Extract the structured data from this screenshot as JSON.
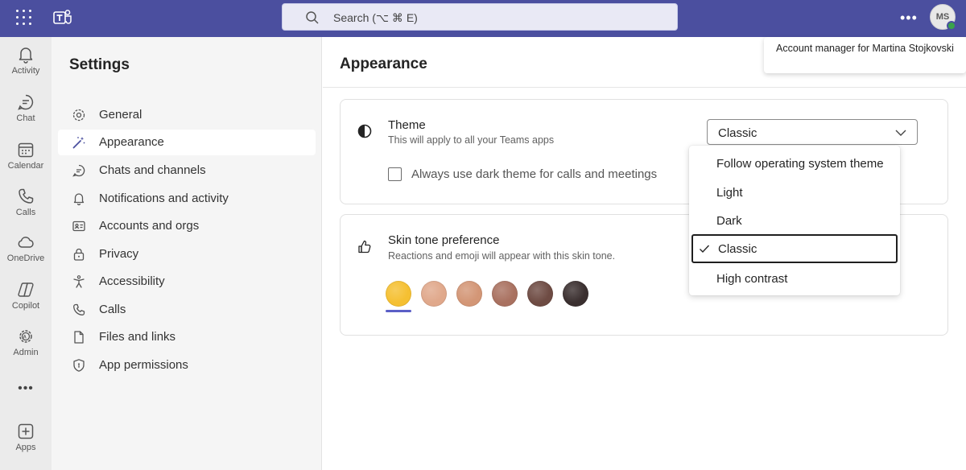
{
  "app": {
    "search_placeholder": "Search (⌥ ⌘ E)",
    "avatar_initials": "MS",
    "account_tooltip": "Account manager for Martina Stojkovski",
    "accent_color": "#4b4f9f",
    "selection_color": "#5b5fc7"
  },
  "rail": {
    "activity": "Activity",
    "chat": "Chat",
    "calendar": "Calendar",
    "calls": "Calls",
    "onedrive": "OneDrive",
    "copilot": "Copilot",
    "admin": "Admin",
    "more": "•••",
    "apps": "Apps"
  },
  "settings": {
    "title": "Settings",
    "nav": {
      "general": "General",
      "appearance": "Appearance",
      "chats": "Chats and channels",
      "notifications": "Notifications and activity",
      "accounts": "Accounts and orgs",
      "privacy": "Privacy",
      "accessibility": "Accessibility",
      "calls": "Calls",
      "files": "Files and links",
      "permissions": "App permissions"
    }
  },
  "appearance": {
    "title": "Appearance",
    "theme": {
      "title": "Theme",
      "subtitle": "This will apply to all your Teams apps",
      "selected": "Classic",
      "dark_calls_label": "Always use dark theme for calls and meetings",
      "dark_calls_checked": false,
      "options": {
        "os": "Follow operating system theme",
        "light": "Light",
        "dark": "Dark",
        "classic": "Classic",
        "contrast": "High contrast"
      }
    },
    "skin": {
      "title": "Skin tone preference",
      "subtitle": "Reactions and emoji will appear with this skin tone.",
      "tones": [
        "#f5c032",
        "#e0a88b",
        "#d39676",
        "#a97160",
        "#6e4b43",
        "#3a2f2f"
      ],
      "selected_index": 0
    }
  }
}
